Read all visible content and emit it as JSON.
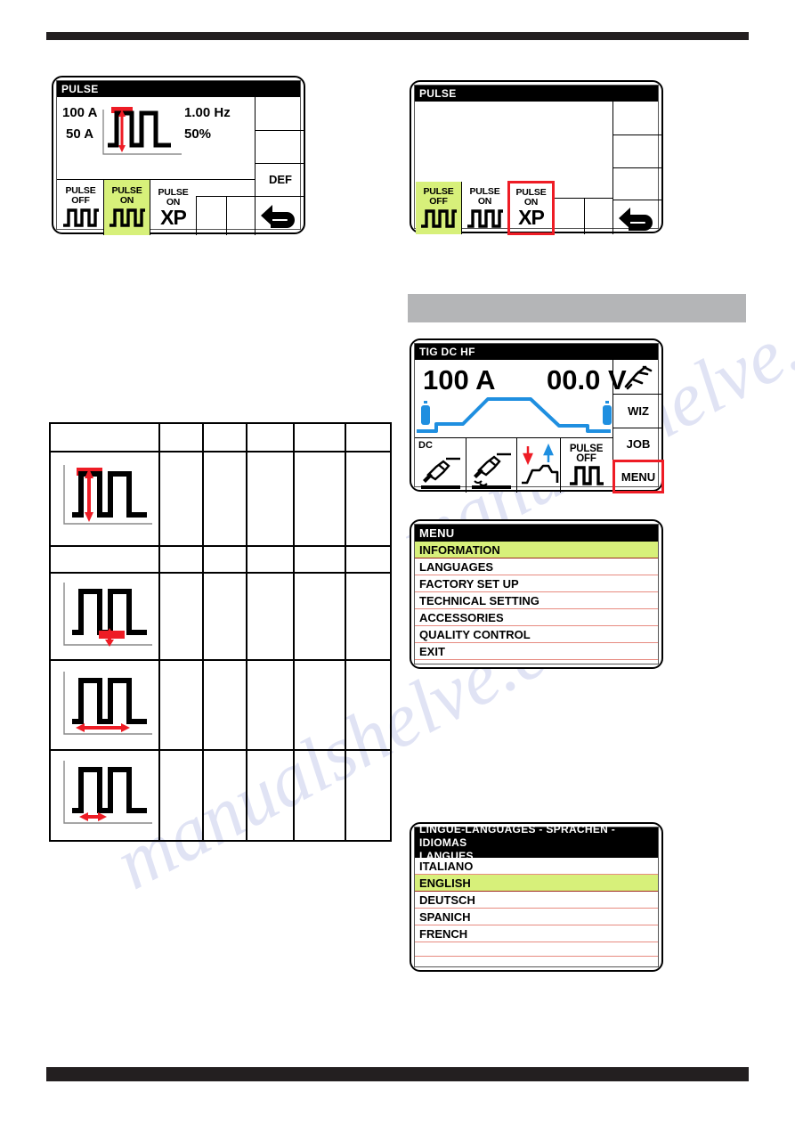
{
  "page": {
    "top_rule_color": "#231f20",
    "bottom_rule_color": "#231f20",
    "accent_select": "#d7f07a",
    "accent_red": "#ee1c25",
    "band_gray": "#b4b5b7",
    "trace_blue": "#1f8fe0"
  },
  "watermark": {
    "line1": "manualshelve.com"
  },
  "pulse_panel_1": {
    "title": "PULSE",
    "peak_current": "100 A",
    "base_current": "50 A",
    "frequency": "1.00 Hz",
    "duty_cycle": "50%",
    "waveform_icon": "pulse-amplitude-waveform-icon",
    "def_key": "DEF",
    "back_key_icon": "back-arrow-icon",
    "softkeys": [
      {
        "line1": "PULSE",
        "line2": "OFF",
        "icon": "square-wave-icon",
        "selected": false,
        "highlight": false
      },
      {
        "line1": "PULSE",
        "line2": "ON",
        "icon": "square-wave-icon",
        "selected": true,
        "highlight": false
      },
      {
        "line1": "PULSE",
        "line2": "ON",
        "icon": "xp-label",
        "selected": false,
        "highlight": false,
        "xp": "XP"
      }
    ]
  },
  "pulse_panel_2": {
    "title": "PULSE",
    "back_key_icon": "back-arrow-icon",
    "softkeys": [
      {
        "line1": "PULSE",
        "line2": "OFF",
        "icon": "square-wave-icon",
        "selected": true,
        "highlight": false
      },
      {
        "line1": "PULSE",
        "line2": "ON",
        "icon": "square-wave-icon",
        "selected": false,
        "highlight": false
      },
      {
        "line1": "PULSE",
        "line2": "ON",
        "icon": "xp-label",
        "selected": false,
        "highlight": true,
        "xp": "XP"
      }
    ]
  },
  "tig_panel": {
    "title": "TIG DC HF",
    "current_value": "100 A",
    "voltage_value": "00.0 V",
    "graph_icon": "welding-cycle-graph-icon",
    "gas_icon_left": "gas-bottle-icon",
    "gas_icon_right": "gas-bottle-icon",
    "softkeys": [
      {
        "label": "DC",
        "icon": "tig-torch-dc-icon"
      },
      {
        "label": "",
        "icon": "tig-torch-hf-strike-icon"
      },
      {
        "label": "",
        "icon": "slope-up-down-icon"
      },
      {
        "line1": "PULSE",
        "line2": "OFF",
        "icon": "square-wave-icon"
      }
    ],
    "right_keys": [
      {
        "label": "",
        "icon": "torch-trigger-icon",
        "highlight": false
      },
      {
        "label": "WIZ",
        "icon": "wizard-key",
        "highlight": false
      },
      {
        "label": "JOB",
        "icon": "job-key",
        "highlight": false
      },
      {
        "label": "MENU",
        "icon": "menu-key",
        "highlight": true
      }
    ]
  },
  "menu_panel": {
    "title": "MENU",
    "items": [
      {
        "label": "INFORMATION",
        "selected": true
      },
      {
        "label": "LANGUAGES",
        "selected": false
      },
      {
        "label": "FACTORY SET UP",
        "selected": false
      },
      {
        "label": "TECHNICAL SETTING",
        "selected": false
      },
      {
        "label": "ACCESSORIES",
        "selected": false
      },
      {
        "label": "QUALITY CONTROL",
        "selected": false
      },
      {
        "label": "EXIT",
        "selected": false
      }
    ]
  },
  "languages_panel": {
    "title_line1": "LINGUE-LANGUAGES - SPRACHEN - IDIOMAS",
    "title_line2": "LANGUES",
    "items": [
      {
        "label": "ITALIANO",
        "selected": false
      },
      {
        "label": "ENGLISH",
        "selected": true
      },
      {
        "label": "DEUTSCH",
        "selected": false
      },
      {
        "label": "SPANICH",
        "selected": false
      },
      {
        "label": "FRENCH",
        "selected": false
      },
      {
        "label": "",
        "selected": false
      },
      {
        "label": "",
        "selected": false
      }
    ]
  },
  "param_table": {
    "header_row": [
      "",
      "",
      "",
      "",
      "",
      ""
    ],
    "rows": [
      {
        "icon": "pulse-peak-amplitude-waveform-icon",
        "cells": [
          "",
          "",
          "",
          "",
          ""
        ]
      },
      {
        "icon": "pulse-base-amplitude-waveform-icon",
        "cells": [
          "",
          "",
          "",
          "",
          ""
        ]
      },
      {
        "icon": "pulse-period-waveform-icon",
        "cells": [
          "",
          "",
          "",
          "",
          ""
        ]
      },
      {
        "icon": "pulse-width-waveform-icon",
        "cells": [
          "",
          "",
          "",
          "",
          ""
        ]
      }
    ]
  }
}
